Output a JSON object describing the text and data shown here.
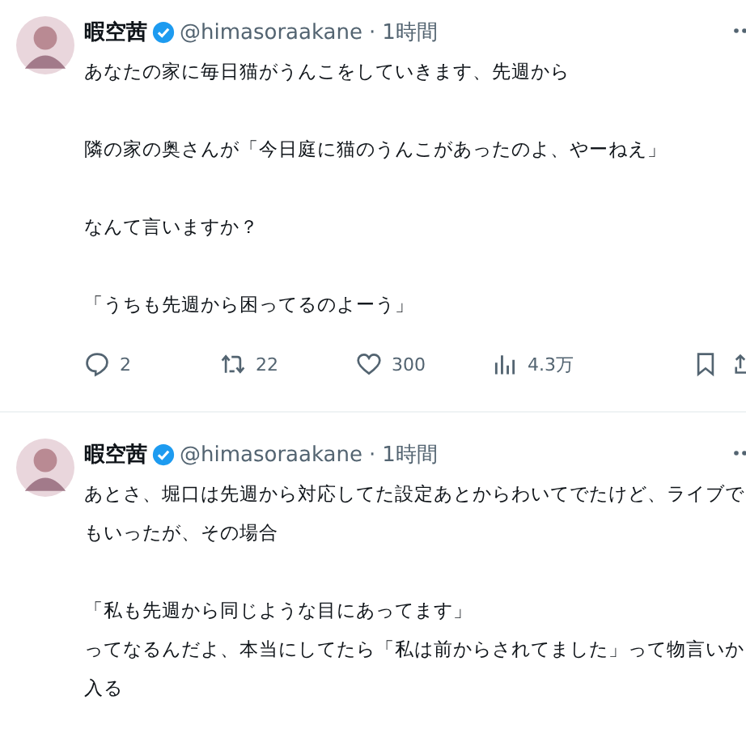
{
  "tweets": [
    {
      "name": "暇空茜",
      "verified": true,
      "handle": "@himasoraakane",
      "separator": "·",
      "time": "1時間",
      "paragraphs": [
        [
          "あなたの家に毎日猫がうんこをしていきます、先週から"
        ],
        [
          "隣の家の奥さんが「今日庭に猫のうんこがあったのよ、やーねえ」"
        ],
        [
          "なんて言いますか？"
        ],
        [
          "「うちも先週から困ってるのよーう」"
        ]
      ],
      "actions": {
        "replies": "2",
        "reposts": "22",
        "likes": "300",
        "views": "4.3万"
      }
    },
    {
      "name": "暇空茜",
      "verified": true,
      "handle": "@himasoraakane",
      "separator": "·",
      "time": "1時間",
      "paragraphs": [
        [
          "あとさ、堀口は先週から対応してた設定あとからわいてでたけど、ライブで",
          "もいったが、その場合"
        ],
        [
          "「私も先週から同じような目にあってます」",
          "ってなるんだよ、本当にしてたら「私は前からされてました」って物言いか",
          "入る"
        ]
      ]
    }
  ]
}
